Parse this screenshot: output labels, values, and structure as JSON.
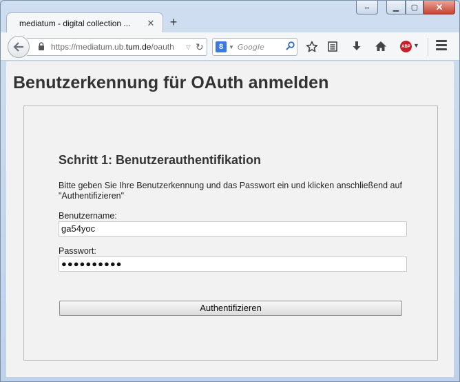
{
  "browser": {
    "tab_title": "mediatum - digital collection ...",
    "tab_close": "✕",
    "new_tab": "+",
    "url_prefix": "https://mediatum.ub.",
    "url_domain": "tum.de",
    "url_suffix": "/oauth",
    "search_engine_icon": "google-icon",
    "search_placeholder": "Google",
    "toolbar_icons": [
      "bookmark-star-icon",
      "reading-list-icon",
      "download-icon",
      "home-icon",
      "adblock-plus-icon",
      "menu-icon"
    ],
    "abp_label": "ABP"
  },
  "page": {
    "title": "Benutzerkennung für OAuth anmelden",
    "step_title": "Schritt 1: Benutzerauthentifikation",
    "instructions": "Bitte geben Sie Ihre Benutzerkennung und das Passwort ein und klicken anschließend auf \"Authentifizieren\"",
    "username_label": "Benutzername:",
    "username_value": "ga54yoc",
    "password_label": "Passwort:",
    "password_value": "●●●●●●●●●●",
    "submit_label": "Authentifizieren"
  },
  "colors": {
    "page_background": "#f2f2f2",
    "title_text": "#333333",
    "window_frame": "#c9d9ec",
    "close_button": "#c7432f"
  }
}
